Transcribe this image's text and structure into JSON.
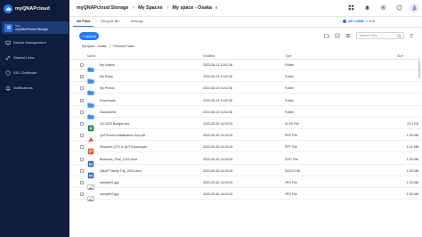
{
  "app": {
    "brand": "myQNAPcloud",
    "storage_sub": "NTA",
    "storage_title": "myQNAPcloud Storage"
  },
  "sidebar": {
    "items": [
      {
        "label": "Device Management",
        "icon": "device-icon"
      },
      {
        "label": "Shared Links",
        "icon": "link-icon"
      },
      {
        "label": "SSL Certificate",
        "icon": "certificate-icon"
      },
      {
        "label": "Notifications",
        "icon": "bell-icon"
      }
    ]
  },
  "header": {
    "app_name": "myQNAPcloud Storage",
    "separator": ">",
    "crumb1": "My Spaces",
    "crumb2": "My space - Osaka",
    "usage_used": "387.24MB",
    "usage_total": "/ 16GB"
  },
  "tabs": [
    {
      "label": "All Files",
      "active": true
    },
    {
      "label": "Recycle Bin",
      "active": false
    },
    {
      "label": "Settings",
      "active": false
    }
  ],
  "toolbar": {
    "upload_label": "+ Upload",
    "search_placeholder": "Search Files"
  },
  "path": {
    "segment1": "My space - Osaka",
    "sep": ">",
    "segment2": "Personal Folder"
  },
  "table": {
    "columns": [
      "Name",
      "Modified",
      "Type",
      "Size"
    ],
    "rows": [
      {
        "name": "My Videos",
        "modified": "2023-08-13 11:02:36",
        "type": "Folder",
        "size": "",
        "icon": "folder-icon"
      },
      {
        "name": "My Music",
        "modified": "2023-08-13 11:02:36",
        "type": "Folder",
        "size": "",
        "icon": "folder-icon"
      },
      {
        "name": "My Photos",
        "modified": "2023-08-13 11:02:36",
        "type": "Folder",
        "size": "",
        "icon": "folder-icon"
      },
      {
        "name": "Downloads",
        "modified": "2023-08-13 11:02:36",
        "type": "Folder",
        "size": "",
        "icon": "folder-icon"
      },
      {
        "name": "Documents",
        "modified": "2023-08-13 11:02:36",
        "type": "Folder",
        "size": "",
        "icon": "folder-icon"
      },
      {
        "name": "Q4 2023 Budget.xlsx",
        "modified": "2023-05-30 14:03:26",
        "type": "XLSX File",
        "size": "23.3 KB",
        "icon": "excel-icon"
      },
      {
        "name": "QuTScloud Initialization Doc.pdf",
        "modified": "2023-05-30 14:03:26",
        "type": "PDF File",
        "size": "1.35 MB",
        "icon": "pdf-icon"
      },
      {
        "name": "Reconen QTS in QuTScloud.pptx",
        "modified": "2023-05-30 14:03:26",
        "type": "PPT File",
        "size": "1.41 MB",
        "icon": "ppt-icon"
      },
      {
        "name": "Business_Plan_1203.docx",
        "modified": "2023-05-30 14:03:26",
        "type": "DOC File",
        "size": "1.35 MB",
        "icon": "word-icon"
      },
      {
        "name": "QNAP Family Trip_2023.docx",
        "modified": "2023-05-30 14:03:26",
        "type": "DOCX File",
        "size": "1.35 MB",
        "icon": "word-icon"
      },
      {
        "name": "sample01.jpg",
        "modified": "2023-05-30 14:03:26",
        "type": "JPG File",
        "size": "1.35 MB",
        "icon": "image-icon"
      },
      {
        "name": "sample02.jpg",
        "modified": "2023-05-30 14:03:26",
        "type": "JPG File",
        "size": "1.35 MB",
        "icon": "image-icon"
      }
    ]
  },
  "colors": {
    "sidebar_bg": "#0f1d3a",
    "accent": "#1f7bff",
    "folder": "#3d8bf5",
    "excel": "#1e7a3c",
    "pdf": "#e0452f",
    "ppt": "#d35230",
    "word": "#2b5fb8"
  }
}
